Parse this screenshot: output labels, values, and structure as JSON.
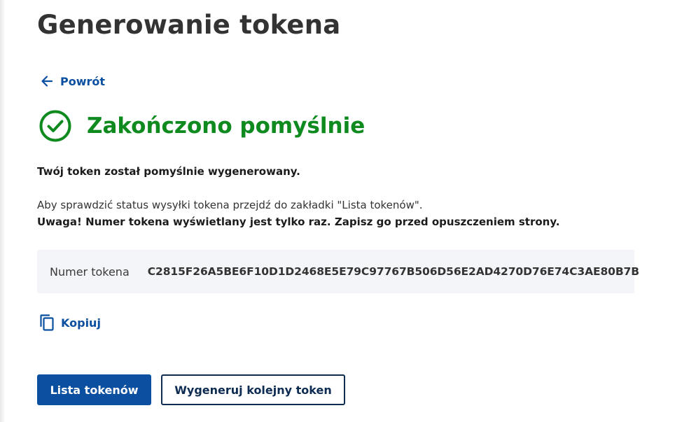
{
  "page": {
    "title": "Generowanie tokena"
  },
  "nav": {
    "back_label": "Powrót",
    "back_icon": "arrow-left-icon"
  },
  "status": {
    "icon": "check-circle-icon",
    "text": "Zakończono pomyślnie",
    "color": "#0f8a1f"
  },
  "messages": {
    "success": "Twój token został pomyślnie wygenerowany.",
    "info": "Aby sprawdzić status wysyłki tokena przejdź do zakładki \"Lista tokenów\".",
    "warning": "Uwaga! Numer tokena wyświetlany jest tylko raz. Zapisz go przed opuszczeniem strony."
  },
  "token": {
    "label": "Numer tokena",
    "value": "C2815F26A5BE6F10D1D2468E5E79C97767B506D56E2AD4270D76E74C3AE80B7B"
  },
  "copy": {
    "label": "Kopiuj",
    "icon": "copy-icon"
  },
  "actions": {
    "list_label": "Lista tokenów",
    "generate_label": "Wygeneruj kolejny token"
  },
  "colors": {
    "primary": "#0b4fa0",
    "success": "#0f8a1f",
    "secondary_border": "#0e2b52",
    "token_box_bg": "#f4f5f8"
  }
}
